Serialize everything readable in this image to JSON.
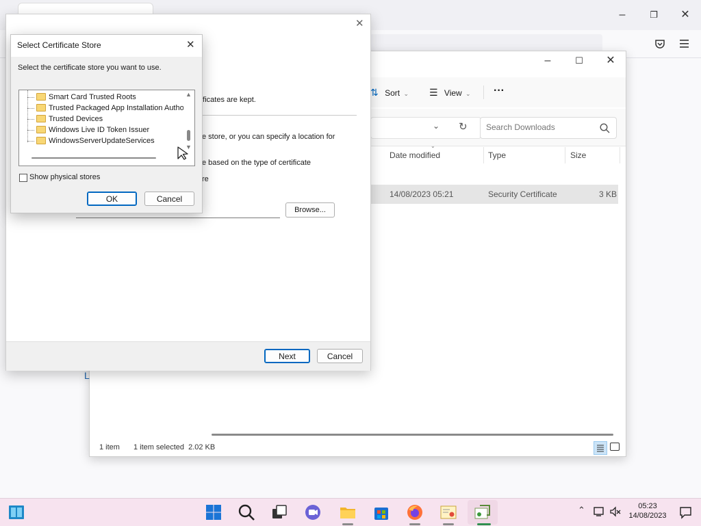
{
  "explorer": {
    "toolbar": {
      "sort_label": "Sort",
      "view_label": "View",
      "more_label": "···"
    },
    "search": {
      "placeholder": "Search Downloads"
    },
    "columns": {
      "date_modified": "Date modified",
      "type": "Type",
      "size": "Size"
    },
    "file": {
      "date_modified": "14/08/2023 05:21",
      "type": "Security Certificate",
      "size": "3 KB"
    },
    "status": {
      "item_count": "1 item",
      "selected": "1 item selected  2.02 KB"
    },
    "left_fragment": "L"
  },
  "wizard": {
    "text_kept": "rtificates are kept.",
    "text_store": "e store, or you can specify a location for",
    "text_based": "e based on the type of certificate",
    "text_re": "re",
    "browse_label": "Browse...",
    "next_label": "Next",
    "cancel_label": "Cancel"
  },
  "store_dialog": {
    "title": "Select Certificate Store",
    "instruction": "Select the certificate store you want to use.",
    "stores": [
      "Smart Card Trusted Roots",
      "Trusted Packaged App Installation Autho",
      "Trusted Devices",
      "Windows Live ID Token Issuer",
      "WindowsServerUpdateServices"
    ],
    "show_physical_label": "Show physical stores",
    "show_physical_checked": false,
    "ok_label": "OK",
    "cancel_label": "Cancel"
  },
  "taskbar": {
    "clock_time": "05:23",
    "clock_date": "14/08/2023"
  },
  "colors": {
    "accent": "#0067c0",
    "taskbar_bg": "#f7e3ef",
    "folder": "#f8d775"
  }
}
